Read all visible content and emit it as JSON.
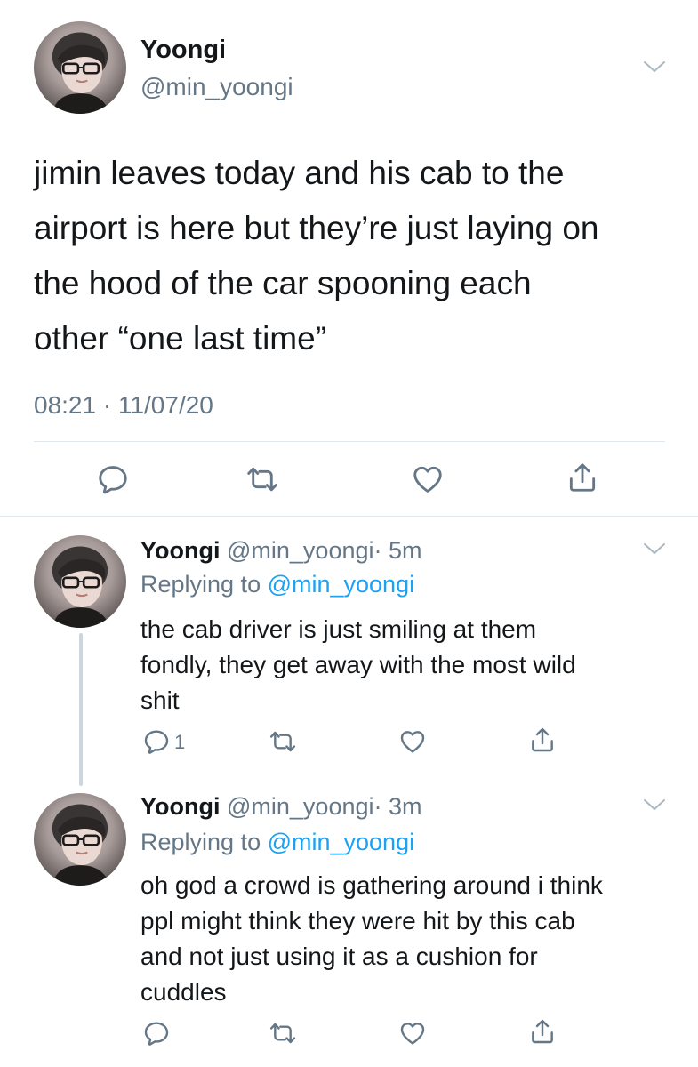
{
  "main_tweet": {
    "display_name": "Yoongi",
    "handle": "@min_yoongi",
    "text_lines": [
      "jimin leaves today and his cab to the",
      "airport is here but they’re just laying on",
      "the hood of the car spooning each",
      "other “one last time”"
    ],
    "timestamp": "08:21 · 11/07/20"
  },
  "replies": [
    {
      "display_name": "Yoongi",
      "handle": "@min_yoongi",
      "time": "· 5m",
      "replying_prefix": "Replying to ",
      "replying_handle": "@min_yoongi",
      "text_lines": [
        "the cab driver is just smiling at them",
        "fondly, they get away with the most wild",
        "shit"
      ],
      "reply_count": "1"
    },
    {
      "display_name": "Yoongi",
      "handle": "@min_yoongi",
      "time": "· 3m",
      "replying_prefix": "Replying to ",
      "replying_handle": "@min_yoongi",
      "text_lines": [
        "oh god a crowd is gathering around i think",
        "ppl might think they were hit by this cab",
        "and not just using it as a cushion for",
        "cuddles"
      ],
      "reply_count": ""
    }
  ],
  "icons": [
    "reply-icon",
    "retweet-icon",
    "like-icon",
    "share-icon",
    "chevron-down-icon"
  ],
  "colors": {
    "text": "#14171a",
    "secondary": "#657786",
    "link": "#1da1f2",
    "divider": "#e1e8ed"
  }
}
